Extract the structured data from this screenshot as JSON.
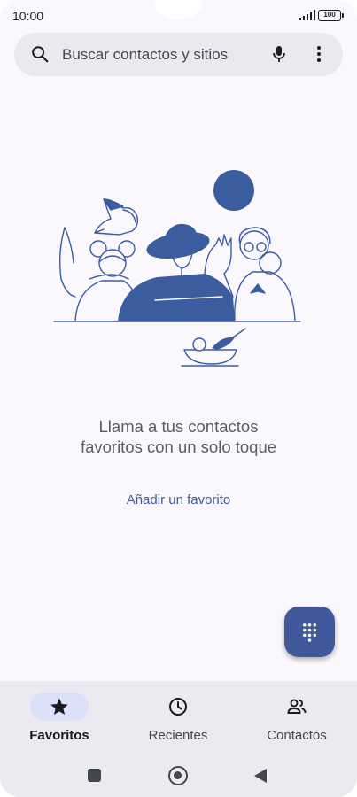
{
  "status_bar": {
    "time": "10:00",
    "battery": "100"
  },
  "search": {
    "placeholder": "Buscar contactos y sitios",
    "icons": [
      "search-icon",
      "mic-icon",
      "more-vert-icon"
    ]
  },
  "empty_state": {
    "message": "Llama a tus contactos favoritos con un solo toque",
    "action": "Añadir un favorito"
  },
  "fab": {
    "icon": "dialpad-icon"
  },
  "bottom_nav": {
    "items": [
      {
        "label": "Favoritos",
        "icon": "star-icon",
        "active": true
      },
      {
        "label": "Recientes",
        "icon": "clock-icon",
        "active": false
      },
      {
        "label": "Contactos",
        "icon": "people-icon",
        "active": false
      }
    ]
  },
  "system_nav": {
    "icons": [
      "recents-square-icon",
      "home-circle-icon",
      "back-triangle-icon"
    ]
  },
  "colors": {
    "accent": "#40599c",
    "link": "#3f5a9c",
    "background": "#fbf8fd",
    "search_bar": "#ebe9f0",
    "nav_background": "#ebeaf0",
    "active_pill": "#dae1f9",
    "illustration_fill": "#3c5ca0"
  }
}
